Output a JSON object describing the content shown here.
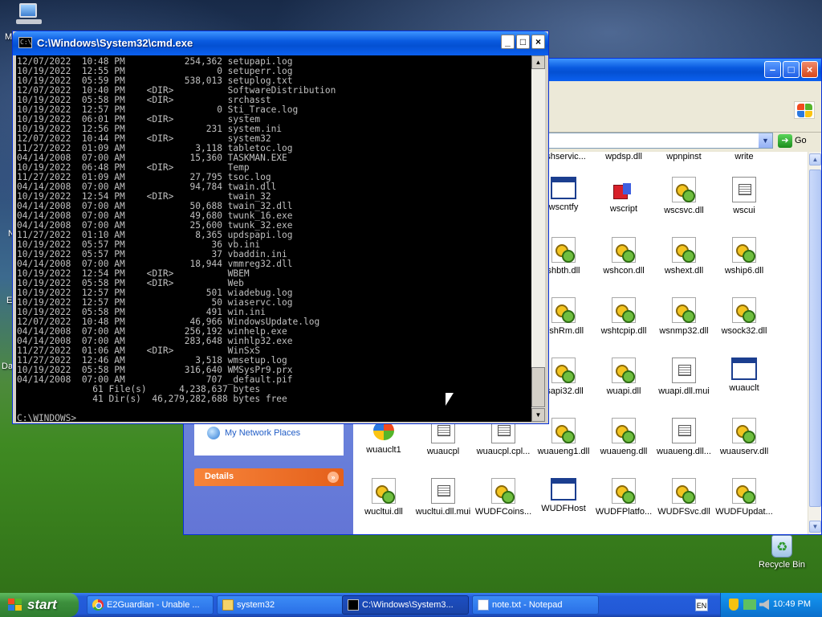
{
  "desktop": {
    "icons": {
      "recycle_bin": "Recycle Bin"
    },
    "edge_letters": [
      "M",
      "N",
      "E",
      "Da"
    ]
  },
  "explorer": {
    "address_go": "Go",
    "taskpane": {
      "network_places": "My Network Places",
      "details_header": "Details"
    },
    "files": [
      {
        "label": "dshservic...",
        "icon": "none"
      },
      {
        "label": "wpdsp.dll",
        "icon": "none"
      },
      {
        "label": "wpnpinst",
        "icon": "none"
      },
      {
        "label": "write",
        "icon": "none"
      },
      {
        "label": "wscntfy",
        "icon": "exe"
      },
      {
        "label": "wscript",
        "icon": "cube"
      },
      {
        "label": "wscsvc.dll",
        "icon": "dll"
      },
      {
        "label": "wscui",
        "icon": "txt"
      },
      {
        "label": "shbth.dll",
        "icon": "dll"
      },
      {
        "label": "wshcon.dll",
        "icon": "dll"
      },
      {
        "label": "wshext.dll",
        "icon": "dll"
      },
      {
        "label": "wship6.dll",
        "icon": "dll"
      },
      {
        "label": "VshRm.dll",
        "icon": "dll"
      },
      {
        "label": "wshtcpip.dll",
        "icon": "dll"
      },
      {
        "label": "wsnmp32.dll",
        "icon": "dll"
      },
      {
        "label": "wsock32.dll",
        "icon": "dll"
      },
      {
        "label": "tsapi32.dll",
        "icon": "dll"
      },
      {
        "label": "wuapi.dll",
        "icon": "dll"
      },
      {
        "label": "wuapi.dll.mui",
        "icon": "txt"
      },
      {
        "label": "wuauclt",
        "icon": "exe"
      },
      {
        "label": "wuauclt1",
        "icon": "win"
      },
      {
        "label": "wuaucpl",
        "icon": "txt"
      },
      {
        "label": "wuaucpl.cpl...",
        "icon": "txt"
      },
      {
        "label": "wuaueng1.dll",
        "icon": "dll"
      },
      {
        "label": "wuaueng.dll",
        "icon": "dll"
      },
      {
        "label": "wuaueng.dll...",
        "icon": "txt"
      },
      {
        "label": "wuauserv.dll",
        "icon": "dll"
      },
      {
        "label": "wucltui.dll",
        "icon": "dll"
      },
      {
        "label": "wucltui.dll.mui",
        "icon": "txt"
      },
      {
        "label": "WUDFCoins...",
        "icon": "dll"
      },
      {
        "label": "WUDFHost",
        "icon": "exe"
      },
      {
        "label": "WUDFPlatfo...",
        "icon": "dll"
      },
      {
        "label": "WUDFSvc.dll",
        "icon": "dll"
      },
      {
        "label": "WUDFUpdat...",
        "icon": "dll"
      }
    ]
  },
  "cmd": {
    "title": "C:\\Windows\\System32\\cmd.exe",
    "icon_text": "C:\\",
    "lines": [
      "12/07/2022  10:48 PM           254,362 setupapi.log",
      "10/19/2022  12:55 PM                 0 setuperr.log",
      "10/19/2022  05:59 PM           538,013 setuplog.txt",
      "12/07/2022  10:40 PM    <DIR>          SoftwareDistribution",
      "10/19/2022  05:58 PM    <DIR>          srchasst",
      "10/19/2022  12:57 PM                 0 Sti_Trace.log",
      "10/19/2022  06:01 PM    <DIR>          system",
      "10/19/2022  12:56 PM               231 system.ini",
      "12/07/2022  10:44 PM    <DIR>          system32",
      "11/27/2022  01:09 AM             3,118 tabletoc.log",
      "04/14/2008  07:00 AM            15,360 TASKMAN.EXE",
      "10/19/2022  06:48 PM    <DIR>          Temp",
      "11/27/2022  01:09 AM            27,795 tsoc.log",
      "04/14/2008  07:00 AM            94,784 twain.dll",
      "10/19/2022  12:54 PM    <DIR>          twain_32",
      "04/14/2008  07:00 AM            50,688 twain_32.dll",
      "04/14/2008  07:00 AM            49,680 twunk_16.exe",
      "04/14/2008  07:00 AM            25,600 twunk_32.exe",
      "11/27/2022  01:10 AM             8,365 updspapi.log",
      "10/19/2022  05:57 PM                36 vb.ini",
      "10/19/2022  05:57 PM                37 vbaddin.ini",
      "04/14/2008  07:00 AM            18,944 vmmreg32.dll",
      "10/19/2022  12:54 PM    <DIR>          WBEM",
      "10/19/2022  05:58 PM    <DIR>          Web",
      "10/19/2022  12:57 PM               501 wiadebug.log",
      "10/19/2022  12:57 PM                50 wiaservc.log",
      "10/19/2022  05:58 PM               491 win.ini",
      "12/07/2022  10:48 PM            46,966 WindowsUpdate.log",
      "04/14/2008  07:00 AM           256,192 winhelp.exe",
      "04/14/2008  07:00 AM           283,648 winhlp32.exe",
      "11/27/2022  01:06 AM    <DIR>          WinSxS",
      "11/27/2022  12:46 AM             3,518 wmsetup.log",
      "10/19/2022  05:58 PM           316,640 WMSysPr9.prx",
      "04/14/2008  07:00 AM               707 _default.pif",
      "              61 File(s)      4,238,637 bytes",
      "              41 Dir(s)  46,279,282,688 bytes free",
      "",
      "C:\\WINDOWS>"
    ]
  },
  "taskbar": {
    "start_label": "start",
    "tasks": [
      {
        "label": "E2Guardian - Unable ...",
        "icon": "chrome",
        "active": false
      },
      {
        "label": "system32",
        "icon": "folder",
        "active": false
      },
      {
        "label": "C:\\Windows\\System3...",
        "icon": "cmdico",
        "active": true
      },
      {
        "label": "note.txt - Notepad",
        "icon": "notepad",
        "active": false
      }
    ],
    "language": "EN",
    "clock": "10:49 PM"
  }
}
